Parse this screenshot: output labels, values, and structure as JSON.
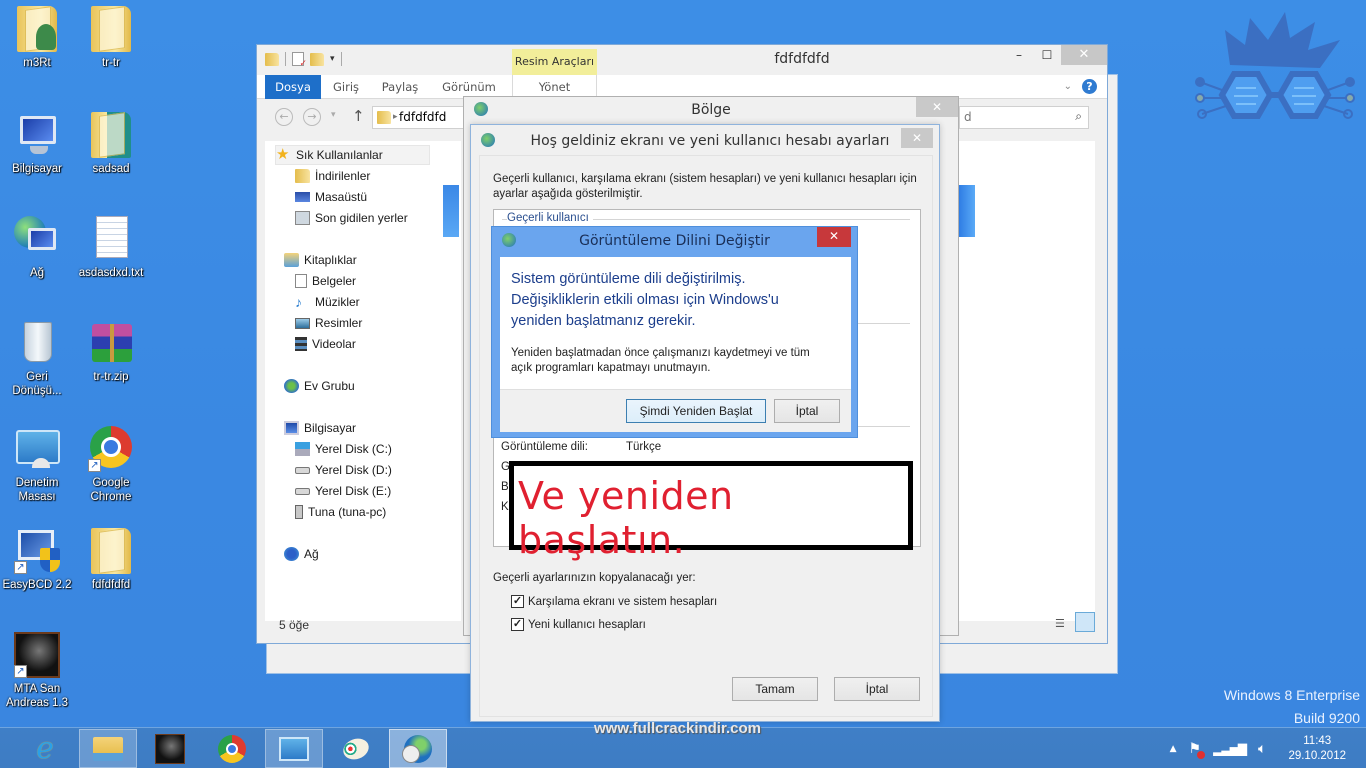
{
  "desktop": {
    "icons": [
      {
        "label": "m3Rt",
        "icon": "user-folder-icon"
      },
      {
        "label": "tr-tr",
        "icon": "folder-icon"
      },
      {
        "label": "Bilgisayar",
        "icon": "computer-icon"
      },
      {
        "label": "sadsad",
        "icon": "folder-icon"
      },
      {
        "label": "Ağ",
        "icon": "network-icon"
      },
      {
        "label": "asdasdxd.txt",
        "icon": "text-file-icon"
      },
      {
        "label": "Geri Dönüşü...",
        "icon": "recycle-bin-icon"
      },
      {
        "label": "tr-tr.zip",
        "icon": "winrar-archive-icon"
      },
      {
        "label": "Denetim Masası",
        "icon": "control-panel-icon"
      },
      {
        "label": "Google Chrome",
        "icon": "chrome-icon"
      },
      {
        "label": "EasyBCD 2.2",
        "icon": "easybcd-icon"
      },
      {
        "label": "fdfdfdfd",
        "icon": "folder-icon"
      },
      {
        "label": "MTA San Andreas 1.3",
        "icon": "mta-icon"
      }
    ],
    "edition_line1": "Windows 8 Enterprise",
    "edition_line2": "Build 9200",
    "watermark": "www.fullcrackindir.com"
  },
  "explorer": {
    "title": "fdfdfdfd",
    "contextual_tab_group": "Resim Araçları",
    "tabs": [
      "Dosya",
      "Giriş",
      "Paylaş",
      "Görünüm",
      "Yönet"
    ],
    "address": "fdfdfdfd",
    "search_partial": "d",
    "nav": [
      {
        "label": "Sık Kullanılanlar",
        "icon": "star-icon",
        "level": 0
      },
      {
        "label": "İndirilenler",
        "icon": "downloads-icon",
        "level": 1
      },
      {
        "label": "Masaüstü",
        "icon": "desktop-icon",
        "level": 1
      },
      {
        "label": "Son gidilen yerler",
        "icon": "recent-places-icon",
        "level": 1
      },
      {
        "label": "Kitaplıklar",
        "icon": "libraries-icon",
        "level": 0
      },
      {
        "label": "Belgeler",
        "icon": "documents-icon",
        "level": 1
      },
      {
        "label": "Müzikler",
        "icon": "music-icon",
        "level": 1
      },
      {
        "label": "Resimler",
        "icon": "pictures-icon",
        "level": 1
      },
      {
        "label": "Videolar",
        "icon": "videos-icon",
        "level": 1
      },
      {
        "label": "Ev Grubu",
        "icon": "homegroup-icon",
        "level": 0
      },
      {
        "label": "Bilgisayar",
        "icon": "computer-icon",
        "level": 0
      },
      {
        "label": "Yerel Disk (C:)",
        "icon": "system-drive-icon",
        "level": 1
      },
      {
        "label": "Yerel Disk (D:)",
        "icon": "drive-icon",
        "level": 1
      },
      {
        "label": "Yerel Disk (E:)",
        "icon": "drive-icon",
        "level": 1
      },
      {
        "label": "Tuna (tuna-pc)",
        "icon": "network-drive-icon",
        "level": 1
      },
      {
        "label": "Ağ",
        "icon": "network-icon",
        "level": 0
      }
    ],
    "status": "5 öğe"
  },
  "bolge": {
    "title": "Bölge"
  },
  "welcome": {
    "title": "Hoş geldiniz ekranı ve yeni kullanıcı hesabı ayarları",
    "intro": "Geçerli kullanıcı, karşılama ekranı (sistem hesapları) ve yeni kullanıcı hesapları için ayarlar aşağıda gösterilmiştir.",
    "group_label": "Geçerli kullanıcı",
    "display_language_label": "Görüntüleme dili:",
    "display_language_value": "Türkçe",
    "hidden_row_initials": [
      "G",
      "Bi",
      "K"
    ],
    "copy_to_label": "Geçerli ayarlarınızın kopyalanacağı yer:",
    "checkboxes": [
      {
        "label": "Karşılama ekranı ve sistem hesapları",
        "checked": true
      },
      {
        "label": "Yeni kullanıcı hesapları",
        "checked": true
      }
    ],
    "ok_label": "Tamam",
    "cancel_label": "İptal"
  },
  "message": {
    "title": "Görüntüleme Dilini Değiştir",
    "main_line1": "Sistem görüntüleme dili değiştirilmiş.",
    "main_line2": "Değişikliklerin etkili olması için Windows'u",
    "main_line3": "yeniden başlatmanız gerekir.",
    "sub_line1": "Yeniden başlatmadan önce çalışmanızı kaydetmeyi ve tüm",
    "sub_line2": "açık programları kapatmayı unutmayın.",
    "restart_label": "Şimdi Yeniden Başlat",
    "cancel_label": "İptal"
  },
  "annotation": {
    "text": "Ve yeniden başlatın."
  },
  "taskbar": {
    "items": [
      {
        "name": "internet-explorer",
        "state": "pinned"
      },
      {
        "name": "file-explorer",
        "state": "open"
      },
      {
        "name": "mta",
        "state": "pinned"
      },
      {
        "name": "chrome",
        "state": "pinned"
      },
      {
        "name": "control-panel",
        "state": "open"
      },
      {
        "name": "paint",
        "state": "pinned"
      },
      {
        "name": "region-clock",
        "state": "active"
      }
    ],
    "time": "11:43",
    "date": "29.10.2012"
  }
}
